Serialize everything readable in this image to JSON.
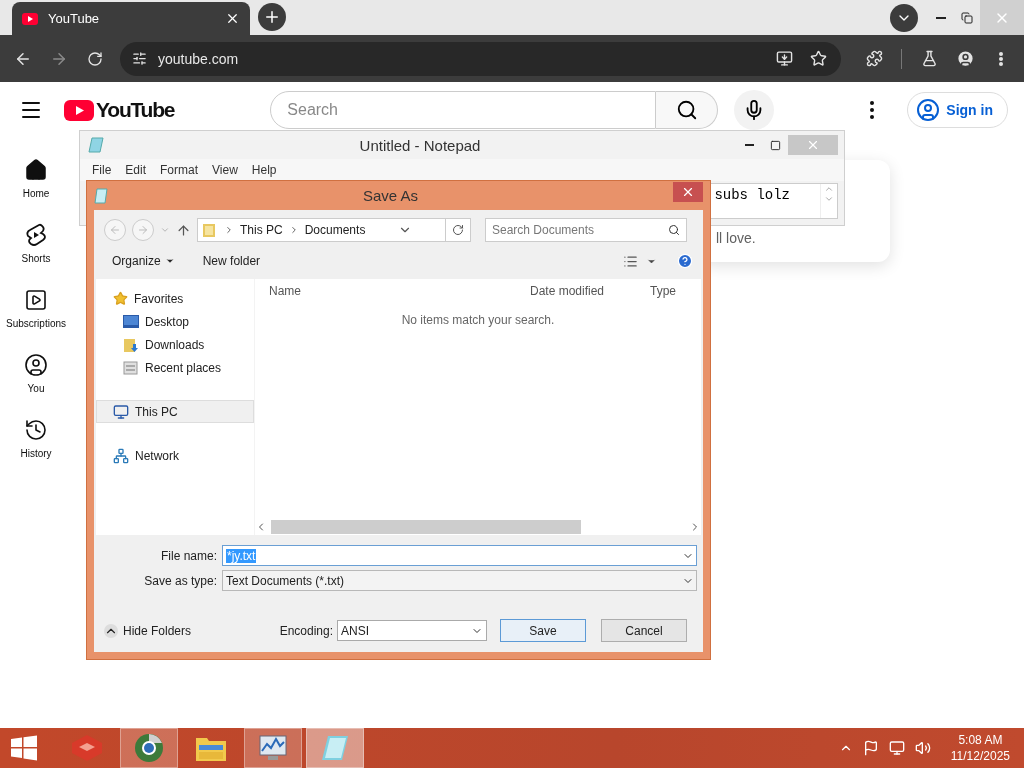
{
  "browser": {
    "tab": {
      "title": "YouTube"
    },
    "address": "youtube.com"
  },
  "youtube": {
    "logo_text": "YouTube",
    "search_placeholder": "Search",
    "sign_in": "Sign in",
    "nav": [
      {
        "label": "Home",
        "kind": "home"
      },
      {
        "label": "Shorts",
        "kind": "shorts"
      },
      {
        "label": "Subscriptions",
        "kind": "subscriptions"
      },
      {
        "label": "You",
        "kind": "you"
      },
      {
        "label": "History",
        "kind": "history"
      }
    ],
    "card_text": "ll love."
  },
  "notepad": {
    "title": "Untitled - Notepad",
    "menu": [
      "File",
      "Edit",
      "Format",
      "View",
      "Help"
    ],
    "text": "subs lolz"
  },
  "save_dialog": {
    "title": "Save As",
    "path": [
      "This PC",
      "Documents"
    ],
    "search_placeholder": "Search Documents",
    "organize": "Organize",
    "new_folder": "New folder",
    "nav": [
      {
        "label": "Favorites",
        "kind": "star",
        "selected": false,
        "children": [
          {
            "label": "Desktop",
            "kind": "desktop",
            "selected": false
          },
          {
            "label": "Downloads",
            "kind": "downloads",
            "selected": false
          },
          {
            "label": "Recent places",
            "kind": "recent",
            "selected": false
          }
        ]
      },
      {
        "label": "This PC",
        "kind": "pc",
        "selected": true
      },
      {
        "label": "Network",
        "kind": "network",
        "selected": false
      }
    ],
    "columns": [
      "Name",
      "Date modified",
      "Type"
    ],
    "empty_message": "No items match your search.",
    "file_name_label": "File name:",
    "file_name": "*jy.txt",
    "file_name_selected": true,
    "type_label": "Save as type:",
    "type": "Text Documents (*.txt)",
    "hide_folders": "Hide Folders",
    "encoding_label": "Encoding:",
    "encoding": "ANSI",
    "buttons": [
      {
        "label": "Save",
        "kind": "default"
      },
      {
        "label": "Cancel",
        "kind": "normal"
      }
    ]
  },
  "taskbar": {
    "apps": [
      {
        "kind": "cube",
        "running": false,
        "selected": false
      },
      {
        "kind": "browser",
        "running": true,
        "selected": false
      },
      {
        "kind": "explorer",
        "running": false,
        "selected": false
      },
      {
        "kind": "monitor",
        "running": true,
        "selected": false
      },
      {
        "kind": "notepad",
        "running": true,
        "selected": true
      }
    ],
    "time": "5:08 AM",
    "date": "11/12/2025"
  }
}
